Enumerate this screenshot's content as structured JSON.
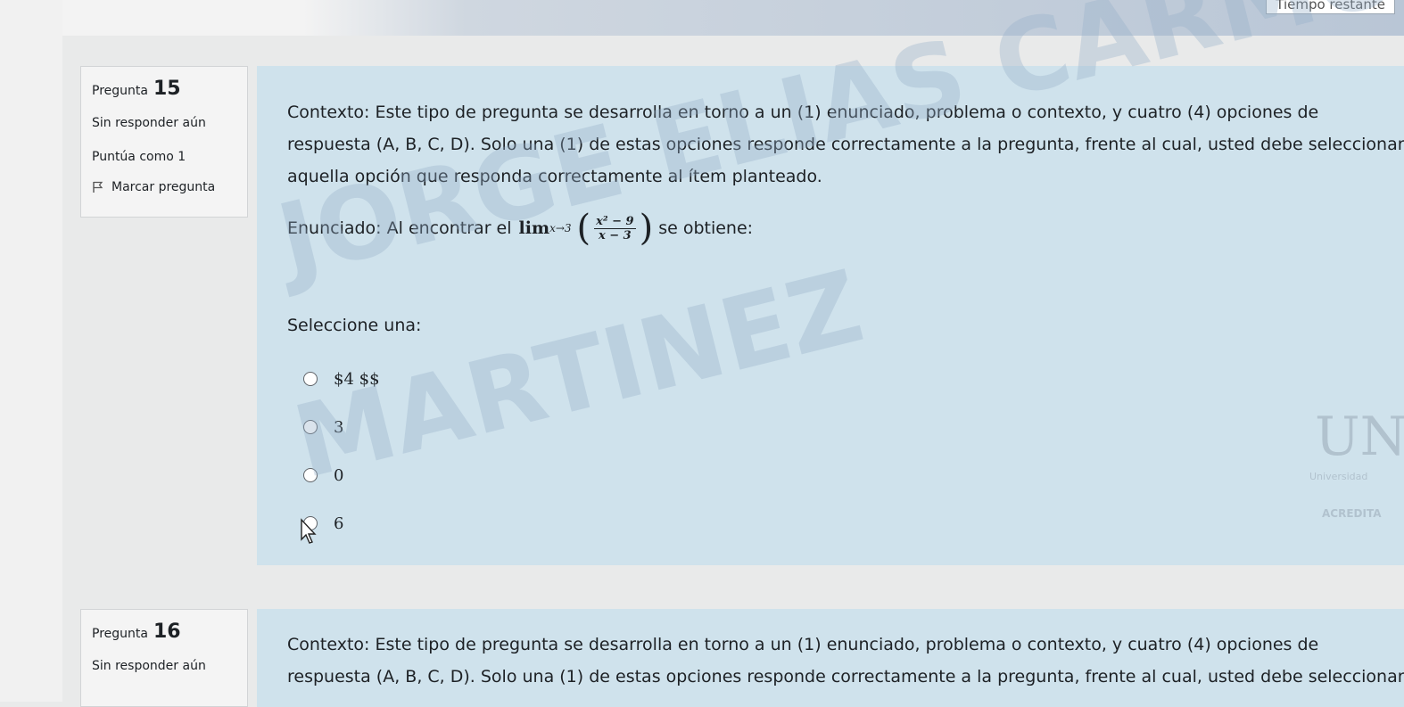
{
  "timer": {
    "label": "Tiempo restante"
  },
  "question15": {
    "number_prefix": "Pregunta",
    "number": "15",
    "state": "Sin responder aún",
    "grade": "Puntúa como 1",
    "flag_label": "Marcar pregunta",
    "context_lines": [
      "Contexto: Este tipo de pregunta se desarrolla en torno a un (1) enunciado, problema o contexto, y cuatro (4) opciones de",
      "respuesta (A, B, C, D). Solo una (1) de estas opciones responde correctamente a la pregunta, frente al cual, usted debe seleccionar",
      "aquella opción que responda correctamente al ítem planteado."
    ],
    "statement_prefix": "Enunciado: Al encontrar el",
    "math": {
      "lim": "lim",
      "sub": "x→3",
      "numerator": "x² − 9",
      "denominator": "x − 3"
    },
    "statement_suffix": "se obtiene:",
    "prompt": "Seleccione una:",
    "options": [
      "$4 $$",
      "3",
      "0",
      "6"
    ]
  },
  "question16": {
    "number_prefix": "Pregunta",
    "number": "16",
    "state": "Sin responder aún",
    "context_lines": [
      "Contexto: Este tipo de pregunta se desarrolla en torno a un (1) enunciado, problema o contexto, y cuatro (4) opciones de",
      "respuesta (A, B, C, D). Solo una (1) de estas opciones responde correctamente a la pregunta, frente al cual, usted debe seleccionar"
    ]
  },
  "watermark": {
    "line1": "JORGE ELIAS CARMONA",
    "line2": "MARTINEZ"
  },
  "logo": {
    "initials": "UN",
    "line1": "Universidad",
    "line2": "ACREDITA"
  },
  "colors": {
    "content_bg": "#cfe2ec",
    "info_bg": "#f4f4f4",
    "text": "#1d2125"
  }
}
